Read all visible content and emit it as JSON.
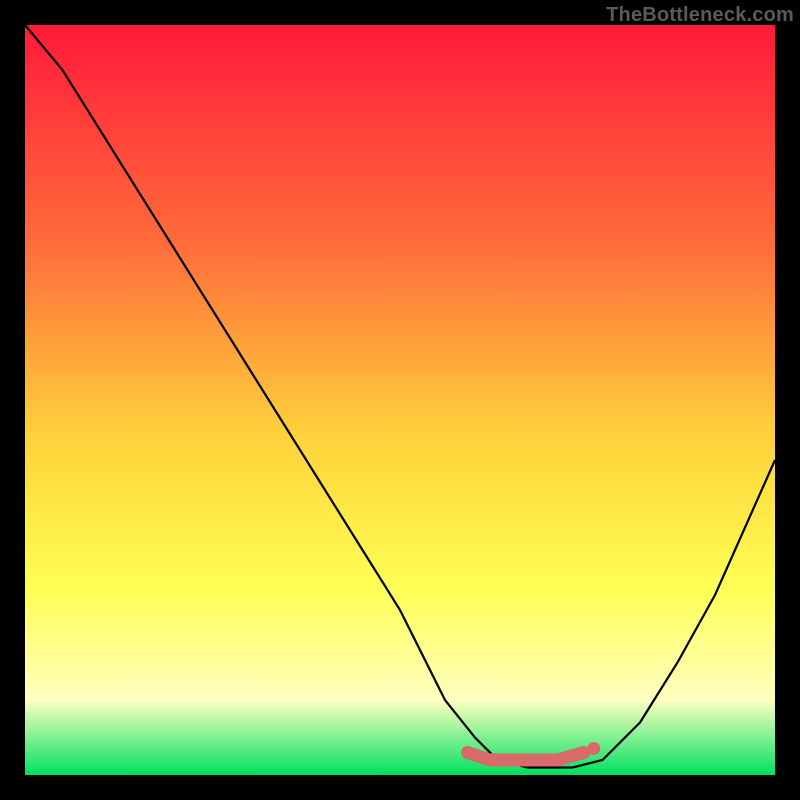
{
  "watermark": "TheBottleneck.com",
  "colors": {
    "bg_black": "#000000",
    "grad_top": "#ff1a3a",
    "grad_mid1": "#ff6f3a",
    "grad_mid2": "#ffd23a",
    "grad_mid3": "#ffff55",
    "grad_low": "#ffffc0",
    "grad_bottom": "#00e060",
    "curve": "#000000",
    "marker_fill": "#d96a6a",
    "marker_stroke": "#d96a6a"
  },
  "chart_data": {
    "type": "line",
    "title": "",
    "xlabel": "",
    "ylabel": "",
    "xlim": [
      0,
      1
    ],
    "ylim": [
      0,
      1
    ],
    "series": [
      {
        "name": "bottleneck-curve",
        "x": [
          0.0,
          0.05,
          0.1,
          0.15,
          0.2,
          0.25,
          0.3,
          0.35,
          0.4,
          0.45,
          0.5,
          0.53,
          0.56,
          0.6,
          0.63,
          0.67,
          0.7,
          0.73,
          0.77,
          0.82,
          0.87,
          0.92,
          0.96,
          1.0
        ],
        "values": [
          1.0,
          0.94,
          0.86,
          0.78,
          0.7,
          0.62,
          0.54,
          0.46,
          0.38,
          0.3,
          0.22,
          0.16,
          0.1,
          0.05,
          0.02,
          0.01,
          0.01,
          0.01,
          0.02,
          0.07,
          0.15,
          0.24,
          0.33,
          0.42
        ]
      }
    ],
    "markers": {
      "name": "highlight-band",
      "x": [
        0.59,
        0.62,
        0.65,
        0.68,
        0.71,
        0.745
      ],
      "values": [
        0.03,
        0.02,
        0.02,
        0.02,
        0.02,
        0.03
      ]
    }
  }
}
